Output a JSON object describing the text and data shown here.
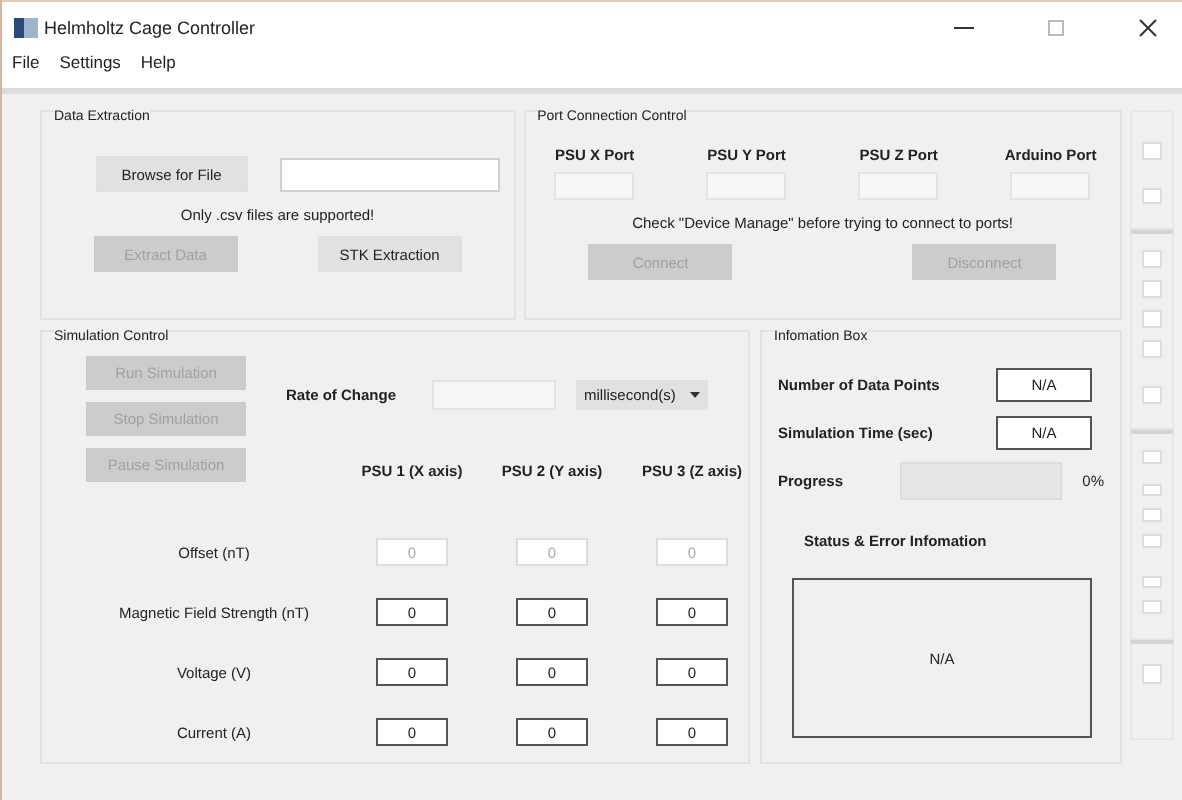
{
  "window": {
    "title": "Helmholtz Cage Controller"
  },
  "menu": [
    "File",
    "Settings",
    "Help"
  ],
  "data_extraction": {
    "title": "Data Extraction",
    "browse_button": {
      "label": "Browse for File",
      "disabled": false
    },
    "note": "Only .csv files are supported!",
    "buttons": [
      {
        "label": "Extract Data",
        "disabled": true
      },
      {
        "label": "STK Extraction",
        "disabled": false
      }
    ]
  },
  "port_connection": {
    "title": "Port Connection Control",
    "ports": [
      "PSU X Port",
      "PSU Y Port",
      "PSU Z Port",
      "Arduino Port"
    ],
    "note": "Check \"Device Manage\" before trying to connect to ports!",
    "buttons": [
      {
        "label": "Connect",
        "disabled": true
      },
      {
        "label": "Disconnect",
        "disabled": true
      }
    ]
  },
  "simulation": {
    "title": "Simulation Control",
    "buttons": [
      {
        "label": "Run Simulation",
        "disabled": true
      },
      {
        "label": "Stop Simulation",
        "disabled": true
      },
      {
        "label": "Pause Simulation",
        "disabled": true
      }
    ],
    "rate_label": "Rate of Change",
    "unit_dropdown": "millisecond(s)",
    "columns": [
      "PSU 1 (X axis)",
      "PSU 2 (Y axis)",
      "PSU 3 (Z axis)"
    ],
    "rows": [
      {
        "label": "Offset (nT)",
        "disabled": true,
        "values": [
          "0",
          "0",
          "0"
        ]
      },
      {
        "label": "Magnetic Field Strength (nT)",
        "disabled": false,
        "values": [
          "0",
          "0",
          "0"
        ]
      },
      {
        "label": "Voltage (V)",
        "disabled": false,
        "values": [
          "0",
          "0",
          "0"
        ]
      },
      {
        "label": "Current (A)",
        "disabled": false,
        "values": [
          "0",
          "0",
          "0"
        ]
      }
    ]
  },
  "information_box": {
    "title": "Infomation Box",
    "fields": [
      {
        "label": "Number of Data Points",
        "value": "N/A"
      },
      {
        "label": "Simulation Time (sec)",
        "value": "N/A"
      }
    ],
    "progress": {
      "label": "Progress",
      "level": 0,
      "reading": "0%"
    },
    "status_title": "Status & Error Infomation",
    "status_value": "N/A"
  },
  "side_checkboxes": [
    [
      {
        "checked": false
      },
      {
        "checked": false
      }
    ],
    [
      {
        "checked": false
      },
      {
        "checked": false
      },
      {
        "checked": false
      },
      {
        "checked": false
      },
      {
        "checked": false
      }
    ],
    [
      {
        "checked": false
      },
      {
        "checked": false
      },
      {
        "checked": false
      },
      {
        "checked": false
      },
      {
        "checked": false
      },
      {
        "checked": false
      }
    ],
    [
      {
        "checked": false
      }
    ]
  ]
}
